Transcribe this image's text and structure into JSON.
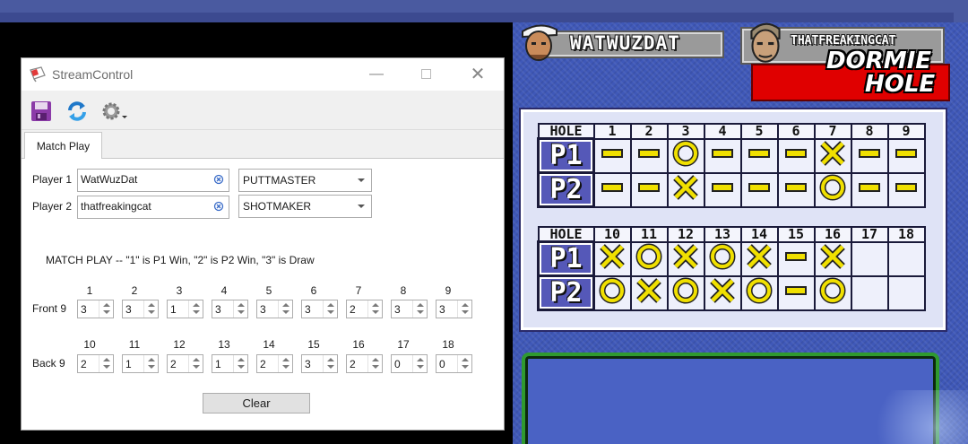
{
  "game": {
    "player1": {
      "name": "WATWUZDAT"
    },
    "player2": {
      "name": "THATFREAKINGCAT"
    },
    "status": {
      "line1": "DORMIE",
      "line2": "HOLE"
    },
    "scoreboard": {
      "hole_label": "HOLE",
      "p1_label": "P1",
      "p2_label": "P2",
      "front": {
        "holes": [
          "1",
          "2",
          "3",
          "4",
          "5",
          "6",
          "7",
          "8",
          "9"
        ],
        "p1": [
          "dash",
          "dash",
          "circle",
          "dash",
          "dash",
          "dash",
          "x",
          "dash",
          "dash"
        ],
        "p2": [
          "dash",
          "dash",
          "x",
          "dash",
          "dash",
          "dash",
          "circle",
          "dash",
          "dash"
        ]
      },
      "back": {
        "holes": [
          "10",
          "11",
          "12",
          "13",
          "14",
          "15",
          "16",
          "17",
          "18"
        ],
        "p1": [
          "x",
          "circle",
          "x",
          "circle",
          "x",
          "dash",
          "x",
          "",
          ""
        ],
        "p2": [
          "circle",
          "x",
          "circle",
          "x",
          "circle",
          "dash",
          "circle",
          "",
          ""
        ]
      }
    }
  },
  "window": {
    "title": "StreamControl",
    "toolbar": {
      "save_icon": "save-icon",
      "refresh_icon": "refresh-icon",
      "settings_icon": "gear-icon"
    },
    "tab": "Match Play",
    "player1": {
      "label": "Player 1",
      "name": "WatWuzDat",
      "character": "PUTTMASTER"
    },
    "player2": {
      "label": "Player 2",
      "name": "thatfreakingcat",
      "character": "SHOTMAKER"
    },
    "instructions": "MATCH PLAY -- \"1\" is P1 Win, \"2\" is P2 Win, \"3\" is Draw",
    "front": {
      "label": "Front 9",
      "holes": [
        "1",
        "2",
        "3",
        "4",
        "5",
        "6",
        "7",
        "8",
        "9"
      ],
      "values": [
        "3",
        "3",
        "1",
        "3",
        "3",
        "3",
        "2",
        "3",
        "3"
      ]
    },
    "back": {
      "label": "Back 9",
      "holes": [
        "10",
        "11",
        "12",
        "13",
        "14",
        "15",
        "16",
        "17",
        "18"
      ],
      "values": [
        "2",
        "1",
        "2",
        "1",
        "2",
        "3",
        "2",
        "0",
        "0"
      ]
    },
    "clear_label": "Clear"
  },
  "colors": {
    "accent_red": "#e00000",
    "mark_yellow": "#f0e000",
    "row_label_blue": "#5558b8"
  }
}
